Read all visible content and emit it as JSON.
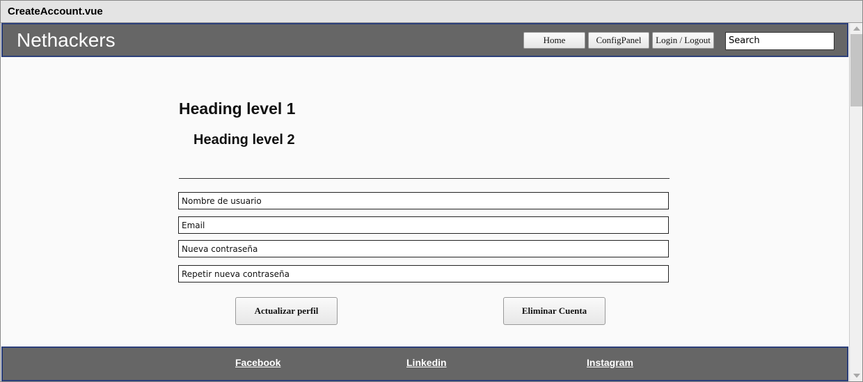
{
  "window": {
    "title": "CreateAccount.vue"
  },
  "header": {
    "brand": "Nethackers",
    "nav": {
      "home": "Home",
      "config": "ConfigPanel",
      "login": "Login / Logout"
    },
    "search_value": "Search"
  },
  "main": {
    "heading1": "Heading level 1",
    "heading2": "Heading level 2",
    "fields": {
      "username": "Nombre de usuario",
      "email": "Email",
      "new_password": "Nueva contraseña",
      "repeat_password": "Repetir nueva contraseña"
    },
    "buttons": {
      "update": "Actualizar perfil",
      "delete": "Eliminar Cuenta"
    }
  },
  "footer": {
    "facebook": "Facebook",
    "linkedin": "Linkedin",
    "instagram": "Instagram"
  },
  "colors": {
    "bar": "#666666",
    "border": "#2c3f7a",
    "page": "#fafafa"
  }
}
